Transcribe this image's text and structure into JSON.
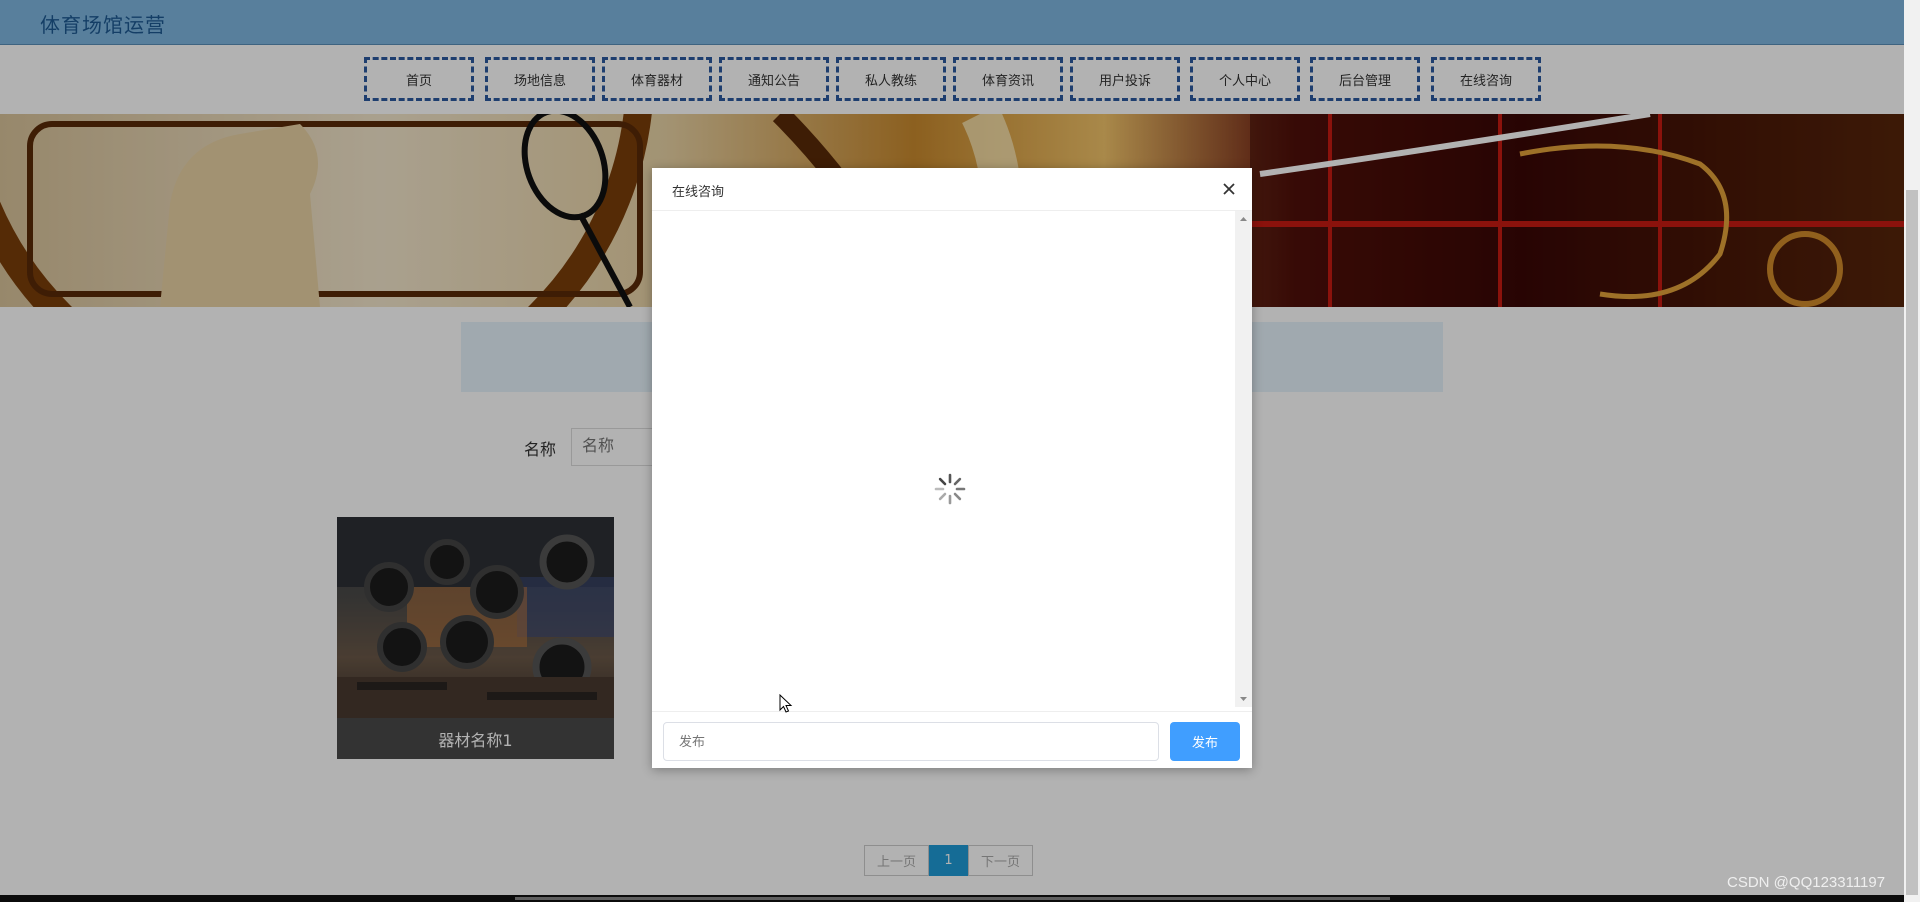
{
  "site": {
    "title": "体育场馆运营"
  },
  "nav": [
    {
      "label": "首页"
    },
    {
      "label": "场地信息"
    },
    {
      "label": "体育器材"
    },
    {
      "label": "通知公告"
    },
    {
      "label": "私人教练"
    },
    {
      "label": "体育资讯"
    },
    {
      "label": "用户投诉"
    },
    {
      "label": "个人中心"
    },
    {
      "label": "后台管理"
    },
    {
      "label": "在线咨询"
    }
  ],
  "search": {
    "label": "名称",
    "placeholder": "名称"
  },
  "card": {
    "caption": "器材名称1"
  },
  "pagination": {
    "prev": "上一页",
    "current": "1",
    "next": "下一页"
  },
  "dialog": {
    "title": "在线咨询",
    "input_placeholder": "发布",
    "submit_label": "发布"
  },
  "watermark": "CSDN @QQ123311197",
  "colors": {
    "topbar": "#7fb7e0",
    "nav_border": "#2c5aa0",
    "primary_button": "#409eff",
    "page_active": "#1f9bd7"
  }
}
